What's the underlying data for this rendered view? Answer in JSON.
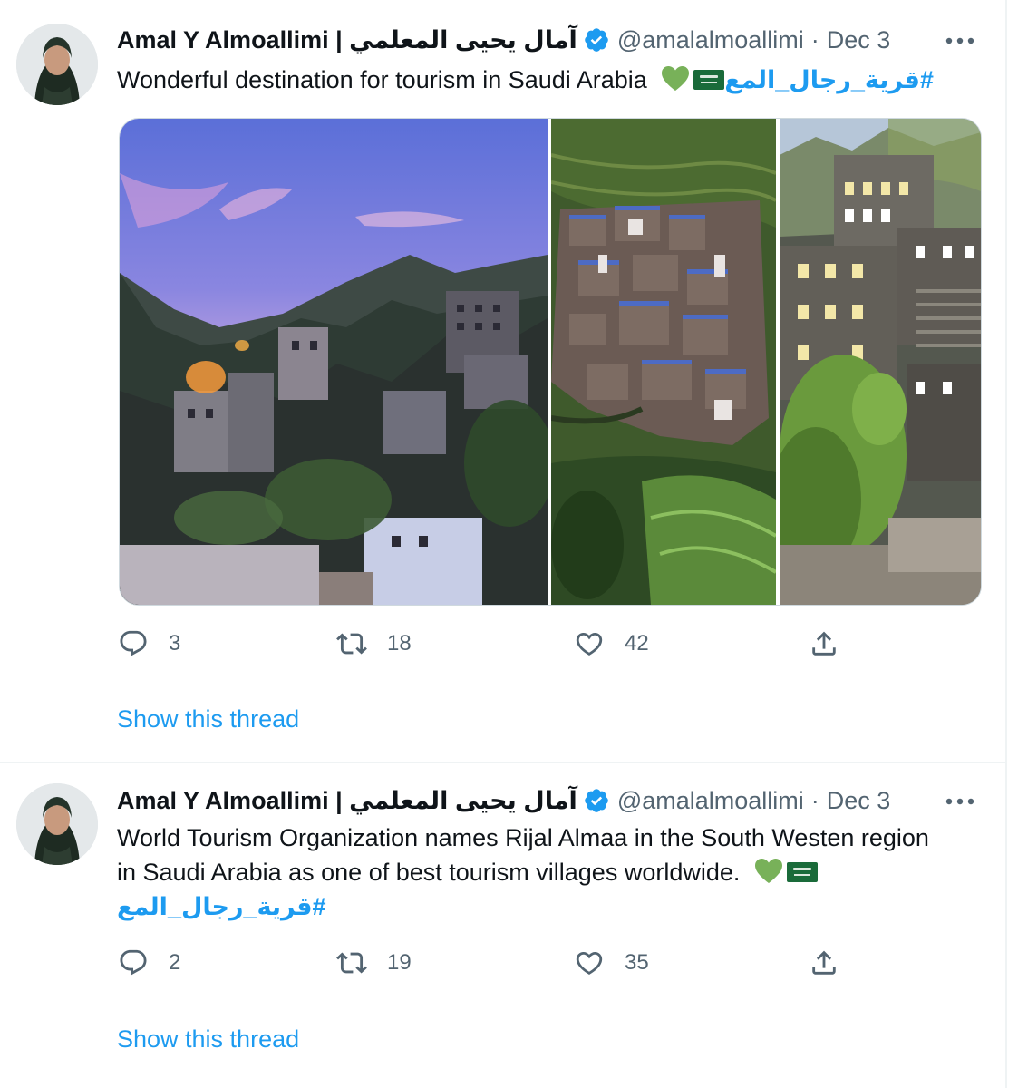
{
  "tweets": [
    {
      "author": {
        "display_name": "Amal Y Almoallimi | آمال يحيى المعلمي",
        "handle": "@amalalmoallimi",
        "verified": true
      },
      "date_separator": "·",
      "date": "Dec 3",
      "text": "Wonderful destination for tourism in Saudi Arabia",
      "hashtag": "#قرية_رجال_المع",
      "emojis": [
        "green-heart",
        "saudi-flag"
      ],
      "media": {
        "photo_count": 3,
        "photos": [
          {
            "description": "village-at-dusk",
            "icon": "photo"
          },
          {
            "description": "terraced-village",
            "icon": "photo"
          },
          {
            "description": "stone-tower-houses",
            "icon": "photo"
          }
        ]
      },
      "stats": {
        "replies": "3",
        "retweets": "18",
        "likes": "42"
      },
      "show_thread": "Show this thread"
    },
    {
      "author": {
        "display_name": "Amal Y Almoallimi | آمال يحيى المعلمي",
        "handle": "@amalalmoallimi",
        "verified": true
      },
      "date_separator": "·",
      "date": "Dec 3",
      "text_line_1": "World Tourism Organization names Rijal Almaa in the South Westen region",
      "text_line_2": "in Saudi Arabia as one of best tourism villages worldwide.",
      "hashtag": "#قرية_رجال_المع",
      "emojis": [
        "green-heart",
        "saudi-flag"
      ],
      "stats": {
        "replies": "2",
        "retweets": "19",
        "likes": "35"
      },
      "show_thread": "Show this thread"
    }
  ],
  "colors": {
    "link": "#1d9bf0",
    "secondary_text": "#536471",
    "primary_text": "#0f1419",
    "divider": "#eff3f4",
    "heart_emoji": "#78b159",
    "flag_green": "#1a6b3a"
  }
}
